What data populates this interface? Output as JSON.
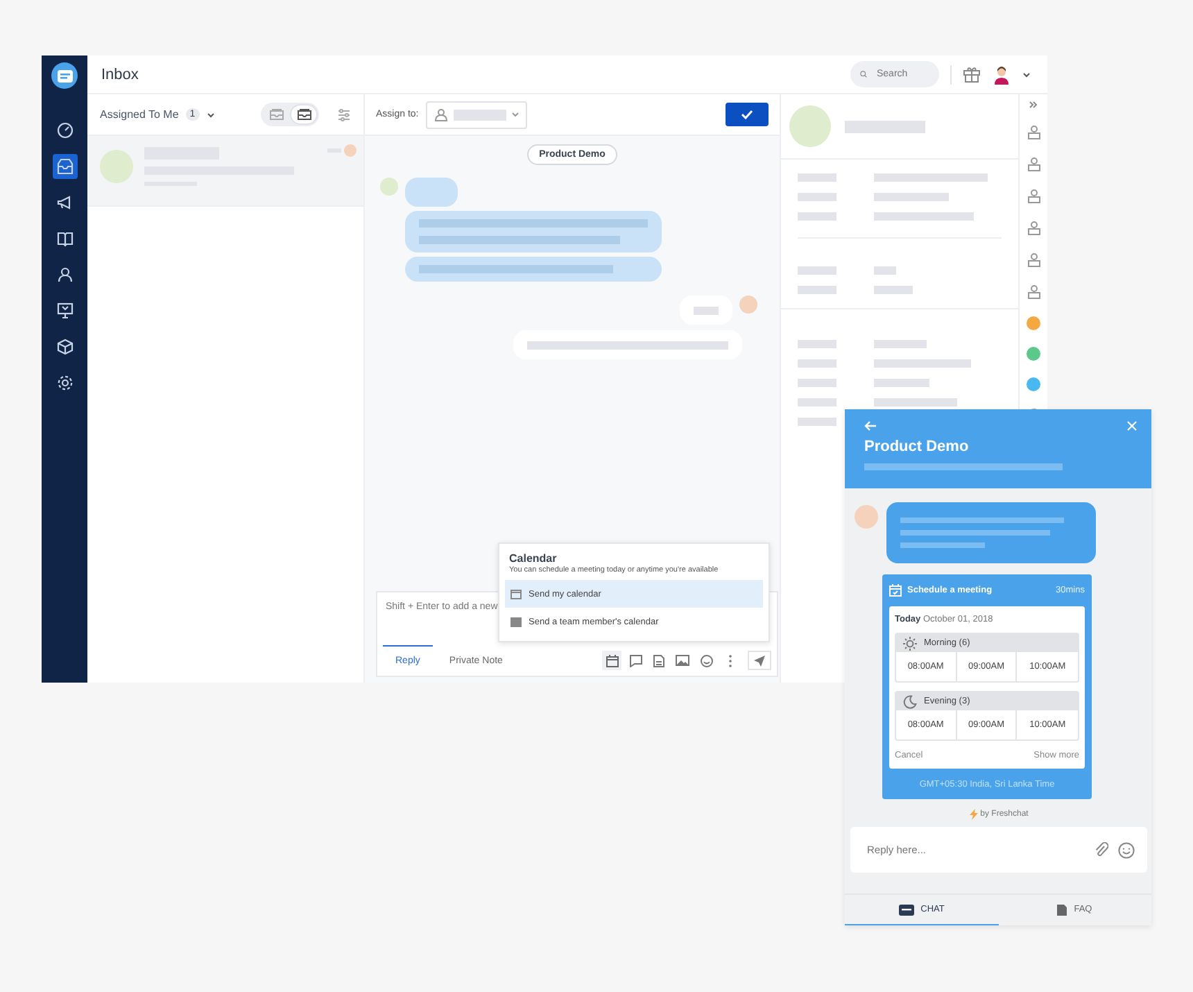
{
  "sidebar": {
    "items": [
      {
        "selected": false
      },
      {
        "selected": true
      },
      {
        "selected": false
      },
      {
        "selected": false
      },
      {
        "selected": false
      },
      {
        "selected": false
      },
      {
        "selected": false
      },
      {
        "selected": false
      }
    ]
  },
  "header": {
    "title": "Inbox",
    "search": {
      "placeholder": "Search"
    }
  },
  "list": {
    "filter": "Assigned To Me",
    "count": "1",
    "view_toggle": [
      {
        "selected": false
      },
      {
        "selected": true
      }
    ]
  },
  "conversation": {
    "assign_label": "Assign to:",
    "topic": "Product Demo",
    "composer": {
      "placeholder": "Shift + Enter to add a new",
      "tabs": [
        {
          "label": "Reply",
          "selected": true
        },
        {
          "label": "Private Note",
          "selected": false
        }
      ]
    },
    "calendar_popup": {
      "title": "Calendar",
      "subtitle": "You can schedule a meeting today or anytime you're available",
      "options": [
        {
          "label": "Send my calendar",
          "selected": true
        },
        {
          "label": "Send a team member's calendar",
          "selected": false
        }
      ]
    }
  },
  "integrations": [
    {
      "color": "#f5a742"
    },
    {
      "color": "#5cc98a"
    },
    {
      "color": "#4ab8f0"
    }
  ],
  "widget": {
    "title": "Product Demo",
    "meeting": {
      "title": "Schedule a meeting",
      "duration": "30mins",
      "date": "**Today** October 01, 2018",
      "groups": [
        {
          "kind": "morning",
          "label": "Morning (6)",
          "slots": [
            "08:00AM",
            "09:00AM",
            "10:00AM"
          ]
        },
        {
          "kind": "evening",
          "label": "Evening (3)",
          "slots": [
            "08:00AM",
            "09:00AM",
            "10:00AM"
          ]
        }
      ],
      "cancel": "Cancel",
      "show_more": "Show more",
      "timezone": "GMT+05:30 India, Sri Lanka Time"
    },
    "branding": "by Freshchat",
    "reply": {
      "placeholder": "Reply here..."
    },
    "tabs": [
      {
        "label": "CHAT",
        "selected": true
      },
      {
        "label": "FAQ",
        "selected": false
      }
    ]
  }
}
